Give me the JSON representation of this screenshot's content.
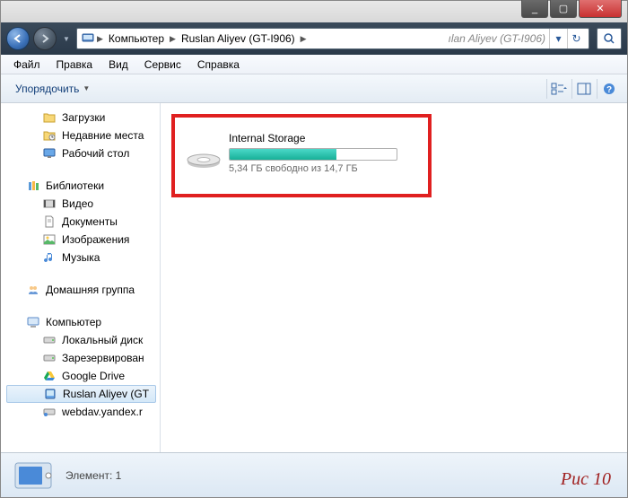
{
  "window_controls": {
    "min": "_",
    "max": "▢",
    "close": "✕"
  },
  "breadcrumb": {
    "items": [
      "Компьютер",
      "Ruslan Aliyev (GT-I906)"
    ],
    "hint": "ılan Aliyev (GT-I906)"
  },
  "menu": {
    "file": "Файл",
    "edit": "Правка",
    "view": "Вид",
    "service": "Сервис",
    "help": "Справка"
  },
  "toolbar": {
    "organize": "Упорядочить"
  },
  "sidebar": {
    "favorites": [
      {
        "label": "Загрузки"
      },
      {
        "label": "Недавние места"
      },
      {
        "label": "Рабочий стол"
      }
    ],
    "libraries_label": "Библиотеки",
    "libraries": [
      {
        "label": "Видео"
      },
      {
        "label": "Документы"
      },
      {
        "label": "Изображения"
      },
      {
        "label": "Музыка"
      }
    ],
    "homegroup": "Домашняя группа",
    "computer_label": "Компьютер",
    "computer": [
      {
        "label": "Локальный диск"
      },
      {
        "label": "Зарезервирован"
      },
      {
        "label": "Google Drive"
      },
      {
        "label": "Ruslan Aliyev (GT",
        "selected": true
      },
      {
        "label": "webdav.yandex.r"
      }
    ]
  },
  "drive": {
    "name": "Internal Storage",
    "free_text": "5,34 ГБ свободно из 14,7 ГБ",
    "percent_used": 64
  },
  "status": {
    "text": "Элемент: 1"
  },
  "caption": "Рис 10"
}
